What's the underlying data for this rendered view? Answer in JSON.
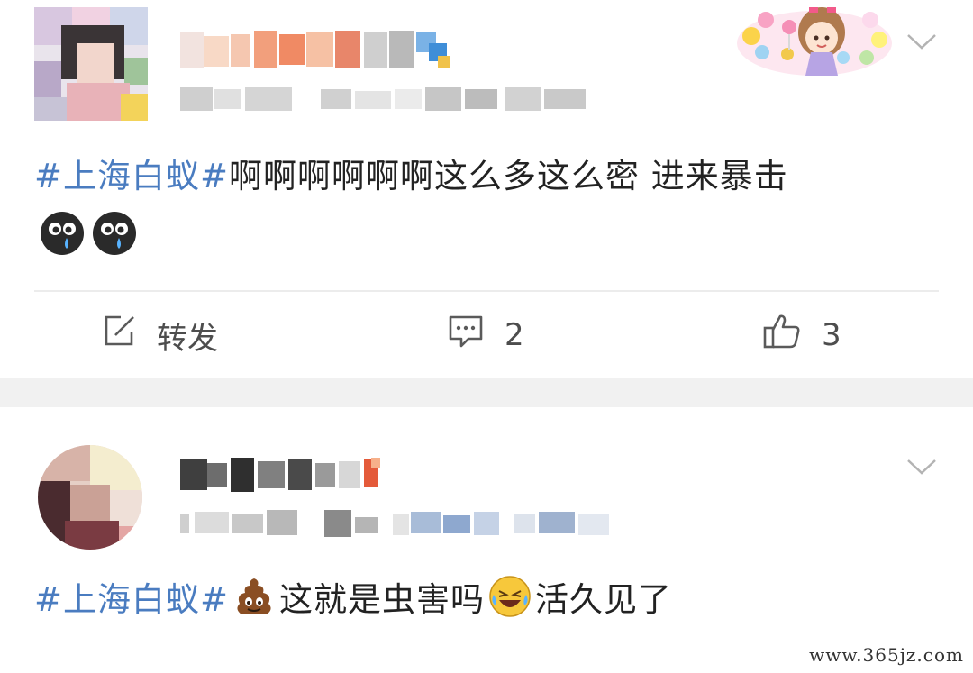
{
  "posts": [
    {
      "content_hashtag": "#上海白蚁#",
      "content_text": "啊啊啊啊啊啊这么多这么密 进来暴击",
      "emoji_row": [
        "crying-face-icon",
        "crying-face-icon"
      ],
      "actions": {
        "forward_label": "转发",
        "comment_count": "2",
        "like_count": "3"
      }
    },
    {
      "content_hashtag": "#上海白蚁#",
      "content_text_1": "这就是虫害吗",
      "content_text_2": "活久见了",
      "emojis": [
        "poop-icon",
        "laughing-crying-icon"
      ]
    }
  ],
  "watermark": "www.365jz.com",
  "colors": {
    "hashtag": "#4a7cc0",
    "text": "#222222",
    "separator": "#f1f1f1"
  }
}
